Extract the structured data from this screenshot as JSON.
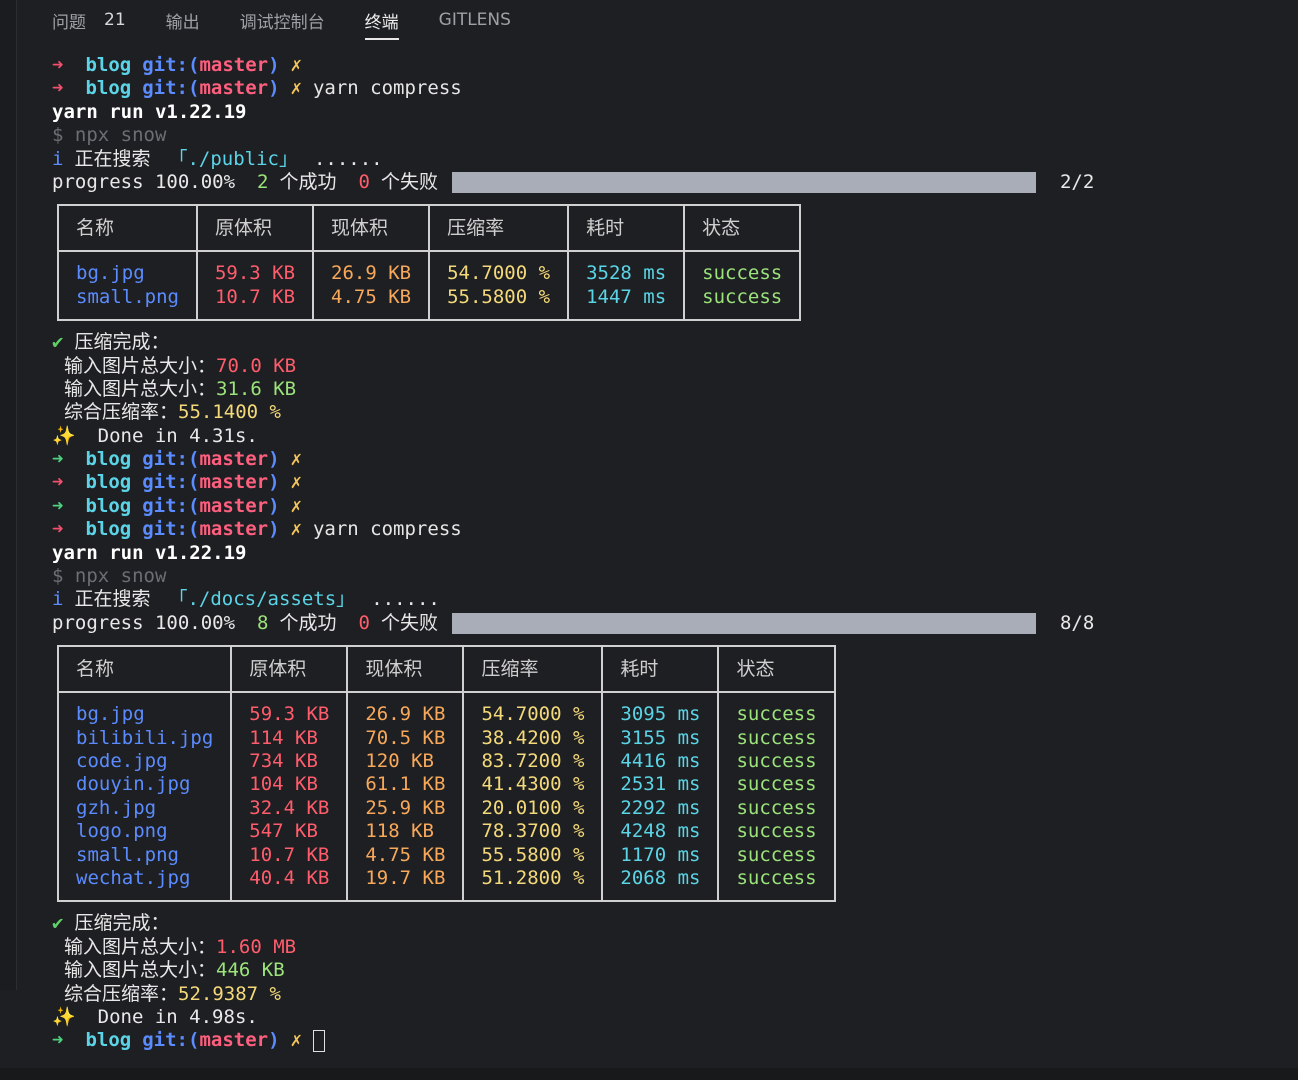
{
  "tabs": [
    {
      "label": "问题",
      "badge": "21"
    },
    {
      "label": "输出"
    },
    {
      "label": "调试控制台"
    },
    {
      "label": "终端",
      "active": true
    },
    {
      "label": "GITLENS"
    }
  ],
  "prompt": {
    "arrow": "➜",
    "dir": "blog",
    "git_label": "git:",
    "open": "(",
    "branch": "master",
    "close": ")",
    "dirty": "✗"
  },
  "block1": {
    "command": "yarn compress",
    "yarn_run": "yarn run v1.22.19",
    "npx": "$ npx snow",
    "search_icon": "i",
    "search_label": "正在搜索",
    "search_path": "「./public」",
    "search_dots": "......",
    "progress_label": "progress 100.00%",
    "ok_count": "2",
    "ok_label": "个成功",
    "fail_count": "0",
    "fail_label": "个失败",
    "fraction": "2/2",
    "progress": 1.0,
    "headers": [
      "名称",
      "原体积",
      "现体积",
      "压缩率",
      "耗时",
      "状态"
    ],
    "rows": [
      {
        "name": "bg.jpg",
        "orig": "59.3 KB",
        "now": "26.9 KB",
        "rate": "54.7000 %",
        "time": "3528 ms",
        "status": "success"
      },
      {
        "name": "small.png",
        "orig": "10.7 KB",
        "now": "4.75 KB",
        "rate": "55.5800 %",
        "time": "1447 ms",
        "status": "success"
      }
    ],
    "done_title": "压缩完成：",
    "input_total_label": "输入图片总大小：",
    "input_total": "70.0 KB",
    "output_total_label": "输入图片总大小：",
    "output_total": "31.6 KB",
    "ratio_label": "综合压缩率：",
    "ratio": "55.1400 %",
    "done_time": "Done in 4.31s."
  },
  "block2": {
    "command": "yarn compress",
    "yarn_run": "yarn run v1.22.19",
    "npx": "$ npx snow",
    "search_icon": "i",
    "search_label": "正在搜索",
    "search_path": "「./docs/assets」",
    "search_dots": "......",
    "progress_label": "progress 100.00%",
    "ok_count": "8",
    "ok_label": "个成功",
    "fail_count": "0",
    "fail_label": "个失败",
    "fraction": "8/8",
    "progress": 1.0,
    "headers": [
      "名称",
      "原体积",
      "现体积",
      "压缩率",
      "耗时",
      "状态"
    ],
    "rows": [
      {
        "name": "bg.jpg",
        "orig": "59.3 KB",
        "now": "26.9 KB",
        "rate": "54.7000 %",
        "time": "3095 ms",
        "status": "success"
      },
      {
        "name": "bilibili.jpg",
        "orig": "114 KB",
        "now": "70.5 KB",
        "rate": "38.4200 %",
        "time": "3155 ms",
        "status": "success"
      },
      {
        "name": "code.jpg",
        "orig": "734 KB",
        "now": "120 KB",
        "rate": "83.7200 %",
        "time": "4416 ms",
        "status": "success"
      },
      {
        "name": "douyin.jpg",
        "orig": "104 KB",
        "now": "61.1 KB",
        "rate": "41.4300 %",
        "time": "2531 ms",
        "status": "success"
      },
      {
        "name": "gzh.jpg",
        "orig": "32.4 KB",
        "now": "25.9 KB",
        "rate": "20.0100 %",
        "time": "2292 ms",
        "status": "success"
      },
      {
        "name": "logo.png",
        "orig": "547 KB",
        "now": "118 KB",
        "rate": "78.3700 %",
        "time": "4248 ms",
        "status": "success"
      },
      {
        "name": "small.png",
        "orig": "10.7 KB",
        "now": "4.75 KB",
        "rate": "55.5800 %",
        "time": "1170 ms",
        "status": "success"
      },
      {
        "name": "wechat.jpg",
        "orig": "40.4 KB",
        "now": "19.7 KB",
        "rate": "51.2800 %",
        "time": "2068 ms",
        "status": "success"
      }
    ],
    "done_title": "压缩完成：",
    "input_total_label": "输入图片总大小：",
    "input_total": "1.60 MB",
    "output_total_label": "输入图片总大小：",
    "output_total": "446 KB",
    "ratio_label": "综合压缩率：",
    "ratio": "52.9387 %",
    "done_time": "Done in 4.98s."
  },
  "glyphs": {
    "check": "✔",
    "sparkle": "✨"
  }
}
